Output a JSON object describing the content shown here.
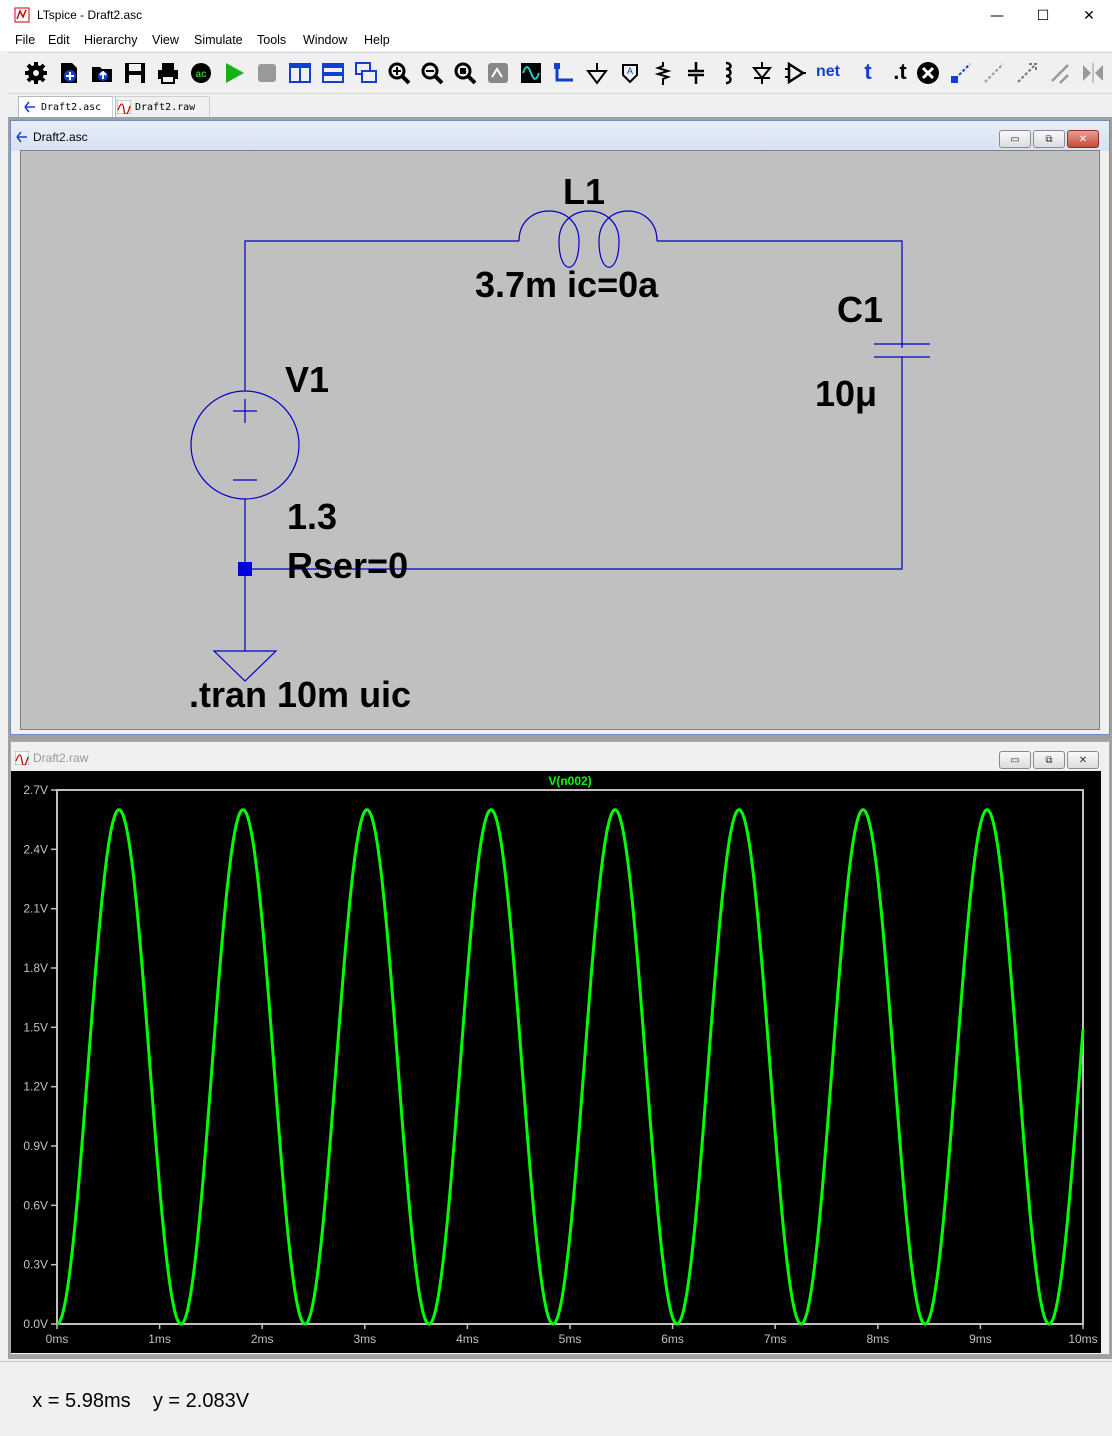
{
  "window": {
    "title": "LTspice - Draft2.asc",
    "minimize": "—",
    "maximize": "☐",
    "close": "✕"
  },
  "menu": [
    "File",
    "Edit",
    "Hierarchy",
    "View",
    "Simulate",
    "Tools",
    "Window",
    "Help"
  ],
  "toolbar": {
    "icons": [
      "settings-icon",
      "new-schematic-icon",
      "open-icon",
      "save-icon",
      "print-icon",
      "ac-analysis-icon",
      "run-icon",
      "halt-icon",
      "tile-vertical-icon",
      "tile-horizontal-icon",
      "cascade-icon",
      "zoom-in-icon",
      "zoom-out-icon",
      "zoom-fit-icon",
      "autorange-icon",
      "waveform-icon",
      "wire-icon",
      "ground-icon",
      "label-net-icon",
      "resistor-icon",
      "capacitor-icon",
      "inductor-icon",
      "diode-icon",
      "component-icon",
      "netlist-icon",
      "text-icon",
      "spice-directive-icon",
      "delete-icon",
      "duplicate-icon",
      "move-icon",
      "drag-icon",
      "undo-icon",
      "redo-icon",
      "mirror-icon"
    ],
    "net_label": "net",
    "text_label": "t",
    "directive_label": ".t",
    "ac_label": "ac"
  },
  "tabs": [
    {
      "label": "Draft2.asc",
      "icon": "schematic-icon"
    },
    {
      "label": "Draft2.raw",
      "icon": "waveform-icon"
    }
  ],
  "schematic_window": {
    "title": "Draft2.asc",
    "components": {
      "inductor": {
        "name": "L1",
        "value": "3.7m ic=0a"
      },
      "capacitor": {
        "name": "C1",
        "value": "10μ"
      },
      "source": {
        "name": "V1",
        "value": "1.3",
        "rser": "Rser=0"
      }
    },
    "directive": ".tran 10m uic",
    "colors": {
      "wire": "#0000c8",
      "background": "#c0c0c0"
    }
  },
  "waveform_window": {
    "title": "Draft2.raw"
  },
  "chart_data": {
    "type": "line",
    "title": "V(n002)",
    "xlabel": "",
    "ylabel": "",
    "x_ticks": [
      "0ms",
      "1ms",
      "2ms",
      "3ms",
      "4ms",
      "5ms",
      "6ms",
      "7ms",
      "8ms",
      "9ms",
      "10ms"
    ],
    "y_ticks": [
      "0.0V",
      "0.3V",
      "0.6V",
      "0.9V",
      "1.2V",
      "1.5V",
      "1.8V",
      "2.1V",
      "2.4V",
      "2.7V"
    ],
    "xlim": [
      0,
      10
    ],
    "ylim": [
      0,
      2.7
    ],
    "grid": false,
    "series": [
      {
        "name": "V(n002)",
        "color": "#00ff00",
        "amplitude": 1.3,
        "offset": 1.3,
        "period_ms": 1.2087,
        "x": [
          0,
          0.6,
          1.21,
          1.81,
          2.42,
          3.02,
          3.63,
          4.23,
          4.84,
          5.44,
          6.04,
          6.65,
          7.25,
          7.86,
          8.46,
          9.07,
          9.67,
          10
        ],
        "values": [
          0,
          2.6,
          0,
          2.6,
          0,
          2.6,
          0,
          2.6,
          0,
          2.6,
          0,
          2.6,
          0,
          2.6,
          0,
          2.6,
          0,
          1.5
        ]
      }
    ]
  },
  "status": {
    "cursor_x": "x = 5.98ms",
    "cursor_y": "y = 2.083V"
  }
}
